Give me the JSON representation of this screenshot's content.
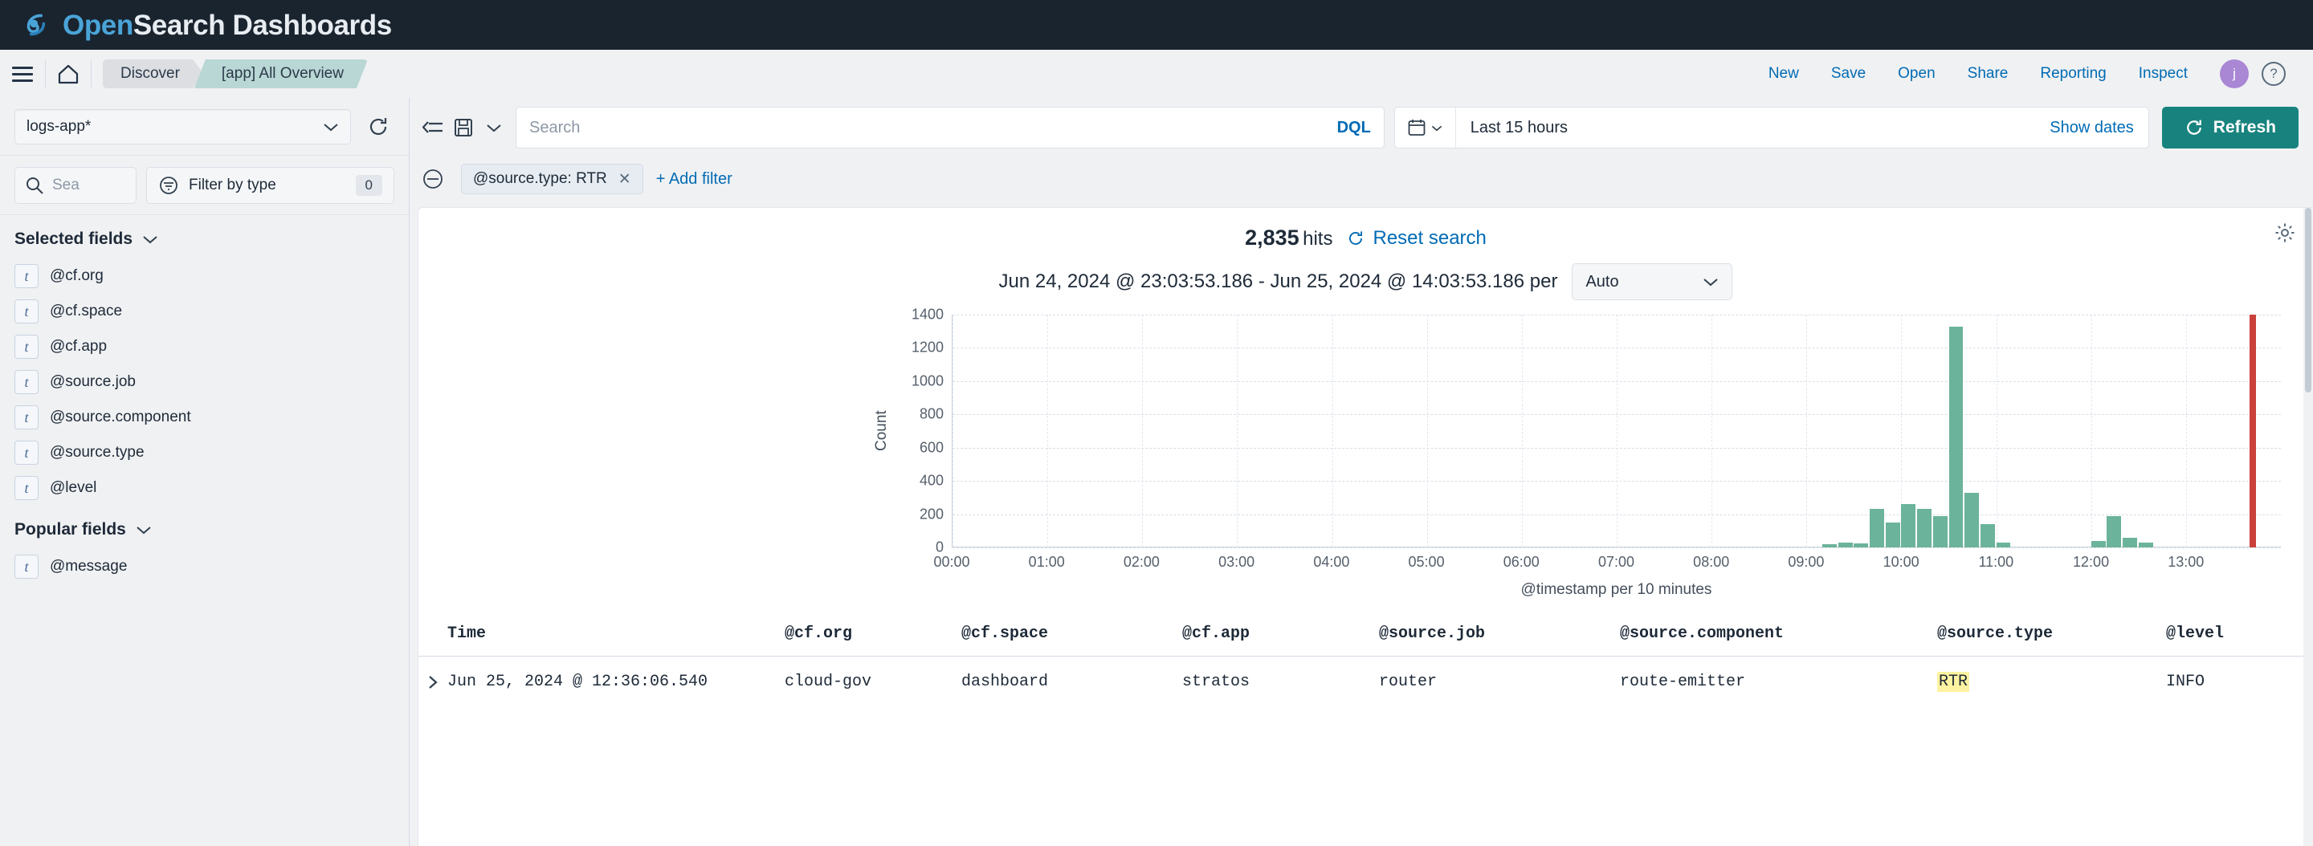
{
  "header": {
    "logo_open": "Open",
    "logo_rest": "Search Dashboards"
  },
  "nav": {
    "menu_icon": "hamburger-menu-icon",
    "home_icon": "home-icon",
    "breadcrumbs": [
      {
        "label": "Discover"
      },
      {
        "label": "[app] All Overview"
      }
    ],
    "links": [
      {
        "label": "New"
      },
      {
        "label": "Save"
      },
      {
        "label": "Open"
      },
      {
        "label": "Share"
      },
      {
        "label": "Reporting"
      },
      {
        "label": "Inspect"
      }
    ],
    "avatar_initial": "j",
    "help_label": "?"
  },
  "sidebar": {
    "index_pattern": "logs-app*",
    "refresh_icon": "refresh-icon",
    "field_search_placeholder": "Sea",
    "filter_by_type_label": "Filter by type",
    "filter_by_type_count": "0",
    "selected_fields_label": "Selected fields",
    "selected_fields": [
      {
        "type": "t",
        "name": "@cf.org"
      },
      {
        "type": "t",
        "name": "@cf.space"
      },
      {
        "type": "t",
        "name": "@cf.app"
      },
      {
        "type": "t",
        "name": "@source.job"
      },
      {
        "type": "t",
        "name": "@source.component"
      },
      {
        "type": "t",
        "name": "@source.type"
      },
      {
        "type": "t",
        "name": "@level"
      }
    ],
    "popular_fields_label": "Popular fields",
    "popular_fields": [
      {
        "type": "t",
        "name": "@message"
      }
    ]
  },
  "query": {
    "search_placeholder": "Search",
    "dql_label": "DQL",
    "date_range": "Last 15 hours",
    "show_dates_label": "Show dates",
    "refresh_label": "Refresh",
    "calendar_icon": "calendar-icon"
  },
  "filters": {
    "filter_pill": "@source.type: RTR",
    "add_filter_label": "+ Add filter"
  },
  "results": {
    "hits_count": "2,835",
    "hits_label": "hits",
    "reset_label": "Reset search",
    "range_text": "Jun 24, 2024 @ 23:03:53.186 - Jun 25, 2024 @ 14:03:53.186 per",
    "interval_value": "Auto",
    "gear_icon": "gear-icon"
  },
  "chart_data": {
    "type": "bar",
    "title": "",
    "xlabel": "@timestamp per 10 minutes",
    "ylabel": "Count",
    "ylim": [
      0,
      1400
    ],
    "yticks": [
      0,
      200,
      400,
      600,
      800,
      1000,
      1200,
      1400
    ],
    "xticks": [
      "00:00",
      "01:00",
      "02:00",
      "03:00",
      "04:00",
      "05:00",
      "06:00",
      "07:00",
      "08:00",
      "09:00",
      "10:00",
      "11:00",
      "12:00",
      "13:00"
    ],
    "grid": true,
    "legend": "none",
    "bar_color": "#6bb39a",
    "last_bar_color": "#c9413a",
    "points": [
      {
        "x": "09:10",
        "y": 20
      },
      {
        "x": "09:20",
        "y": 30
      },
      {
        "x": "09:30",
        "y": 25
      },
      {
        "x": "09:40",
        "y": 230
      },
      {
        "x": "09:50",
        "y": 150
      },
      {
        "x": "10:00",
        "y": 260
      },
      {
        "x": "10:10",
        "y": 230
      },
      {
        "x": "10:20",
        "y": 190
      },
      {
        "x": "10:30",
        "y": 1330
      },
      {
        "x": "10:40",
        "y": 330
      },
      {
        "x": "10:50",
        "y": 140
      },
      {
        "x": "11:00",
        "y": 30
      },
      {
        "x": "12:00",
        "y": 40
      },
      {
        "x": "12:10",
        "y": 190
      },
      {
        "x": "12:20",
        "y": 60
      },
      {
        "x": "12:30",
        "y": 30
      },
      {
        "x": "13:40",
        "y": 1400
      }
    ]
  },
  "table": {
    "columns": [
      "Time",
      "@cf.org",
      "@cf.space",
      "@cf.app",
      "@source.job",
      "@source.component",
      "@source.type",
      "@level"
    ],
    "rows": [
      {
        "time": "Jun 25, 2024 @ 12:36:06.540",
        "cf_org": "cloud-gov",
        "cf_space": "dashboard",
        "cf_app": "stratos",
        "source_job": "router",
        "source_component": "route-emitter",
        "source_type": "RTR",
        "level": "INFO"
      }
    ]
  },
  "colors": {
    "header_bg": "#1a242f",
    "accent_link": "#006bb4",
    "refresh_btn": "#18837e",
    "breadcrumb_active": "#b9d7d4",
    "highlight": "#fdf3a0"
  }
}
